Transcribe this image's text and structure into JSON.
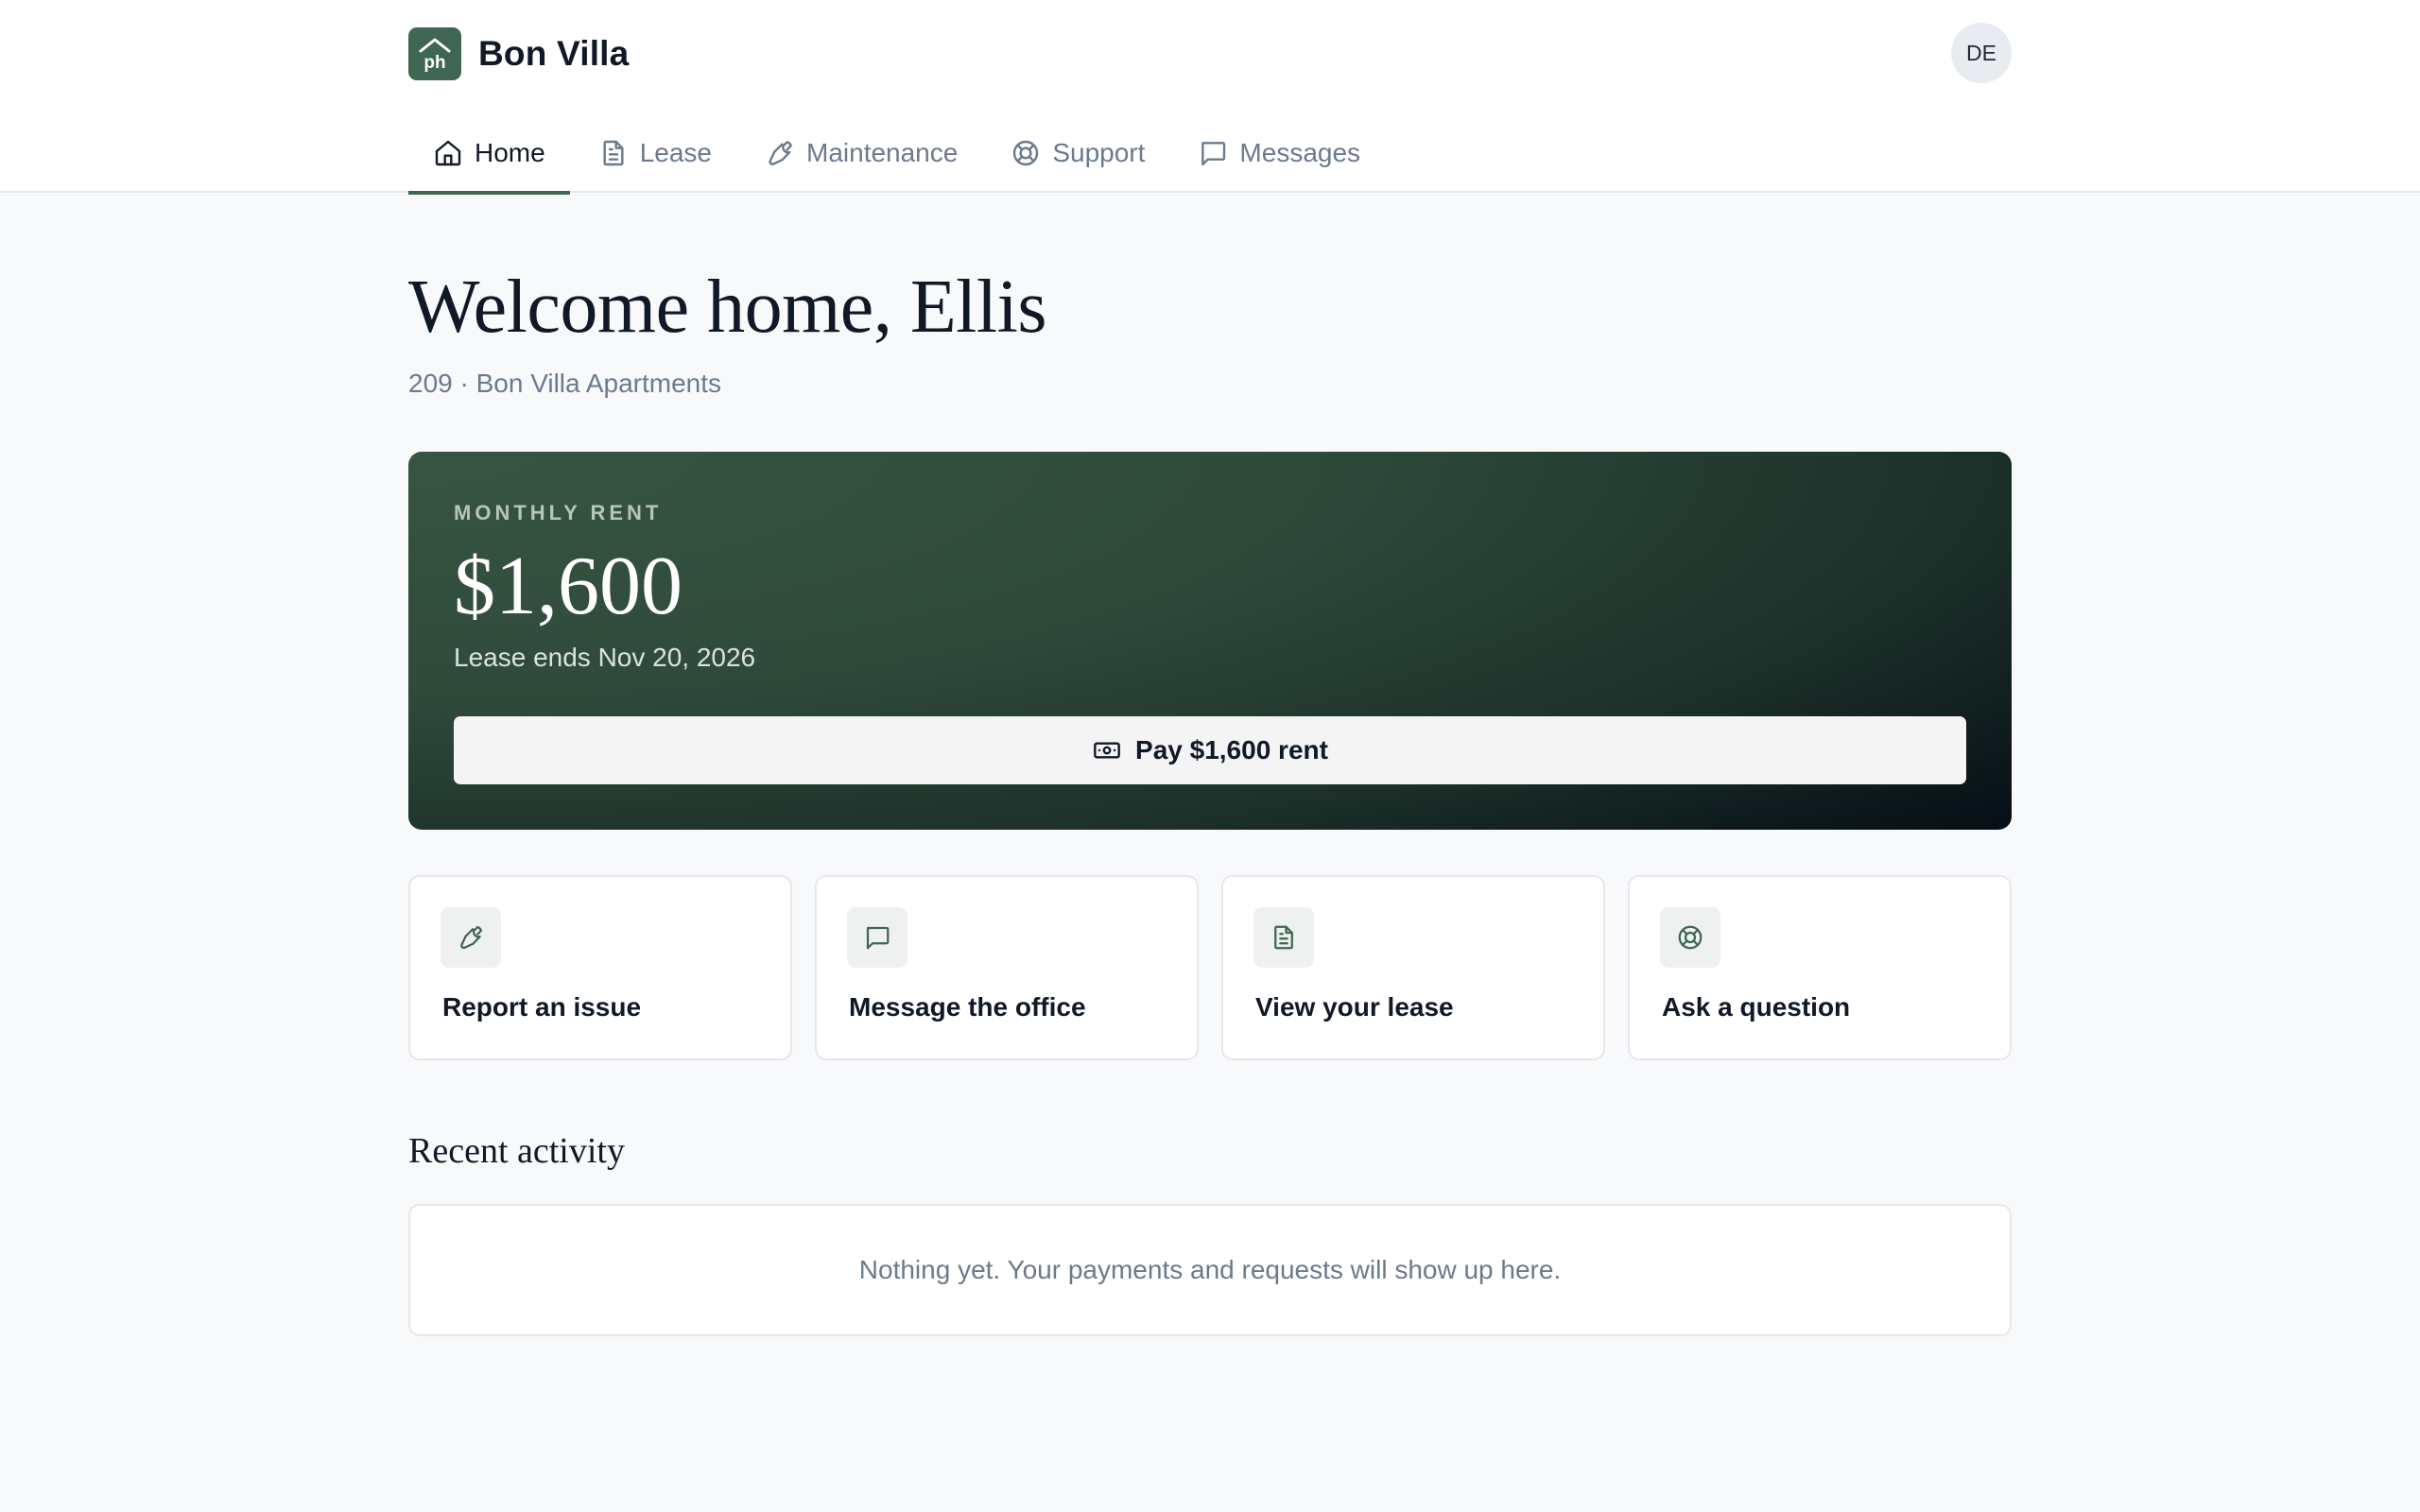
{
  "app": {
    "brand_name": "Bon Villa",
    "logo_text": "ph",
    "user_initials": "DE"
  },
  "nav": {
    "tabs": [
      {
        "label": "Home",
        "icon": "home-icon",
        "active": true
      },
      {
        "label": "Lease",
        "icon": "document-icon",
        "active": false
      },
      {
        "label": "Maintenance",
        "icon": "wrench-icon",
        "active": false
      },
      {
        "label": "Support",
        "icon": "lifebuoy-icon",
        "active": false
      },
      {
        "label": "Messages",
        "icon": "message-icon",
        "active": false
      }
    ]
  },
  "welcome": {
    "title": "Welcome home, Ellis",
    "subtitle": "209 · Bon Villa Apartments"
  },
  "rent": {
    "label": "MONTHLY RENT",
    "amount": "$1,600",
    "lease_ends": "Lease ends Nov 20, 2026",
    "pay_button_label": "Pay $1,600 rent",
    "pay_icon": "cash-icon"
  },
  "quick_actions": [
    {
      "label": "Report an issue",
      "icon": "wrench-icon"
    },
    {
      "label": "Message the office",
      "icon": "message-icon"
    },
    {
      "label": "View your lease",
      "icon": "document-icon"
    },
    {
      "label": "Ask a question",
      "icon": "lifebuoy-icon"
    }
  ],
  "recent_activity": {
    "title": "Recent activity",
    "empty_message": "Nothing yet. Your payments and requests will show up here."
  },
  "colors": {
    "brand": "#3f6553",
    "text_primary": "#111827",
    "text_muted": "#6b7a8d",
    "page_background": "#f8f9fa"
  }
}
